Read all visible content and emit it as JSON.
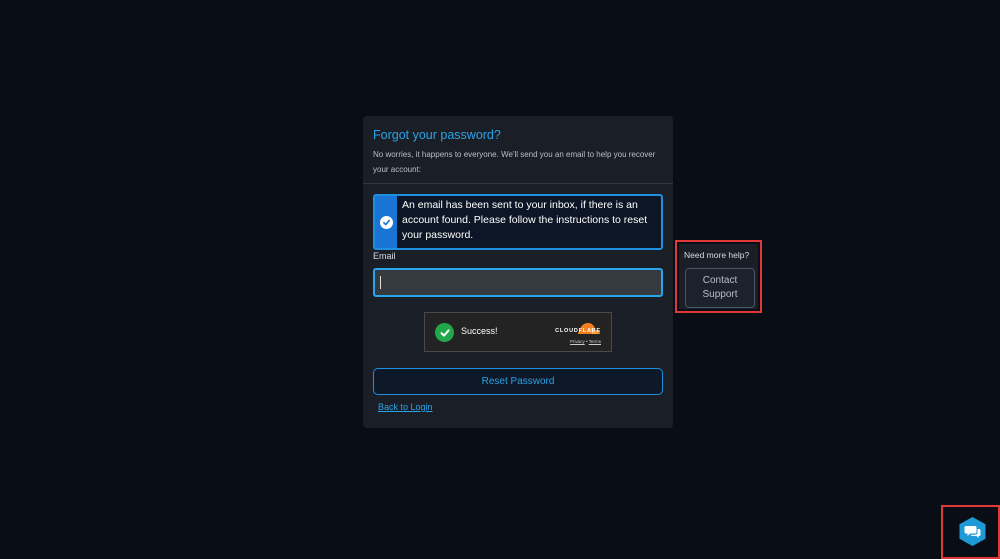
{
  "reset_card": {
    "title": "Forgot your password?",
    "subtitle": "No worries, it happens to everyone. We'll send you an email to help you recover your account:",
    "alert_message": "An email has been sent to your inbox, if there is an account found. Please follow the instructions to reset your password.",
    "email_label": "Email",
    "email_value": "",
    "reset_button_label": "Reset Password",
    "back_link_label": "Back to Login"
  },
  "captcha": {
    "status_text": "Success!",
    "brand": "CLOUDFLARE",
    "privacy_label": "Privacy",
    "separator": "•",
    "terms_label": "Terms",
    "check_color": "#20a84a",
    "brand_color": "#f38020"
  },
  "help_panel": {
    "title": "Need more help?",
    "contact_button_label": "Contact Support"
  },
  "chat_widget": {
    "icon": "chat-bubbles-icon",
    "color": "#1e9ad6"
  },
  "colors": {
    "accent": "#2aa2e6",
    "alert_border": "#1f8fe0",
    "highlight_outline": "#e23838"
  }
}
